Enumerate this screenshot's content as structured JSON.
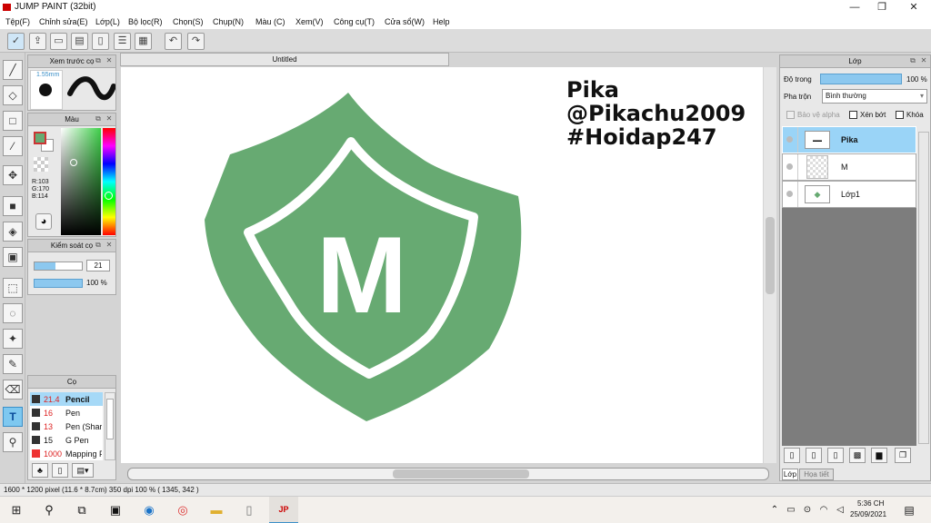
{
  "window": {
    "title": "JUMP PAINT (32bit)"
  },
  "menu": [
    "Tệp(F)",
    "Chỉnh sửa(E)",
    "Lớp(L)",
    "Bộ lọc(R)",
    "Chọn(S)",
    "Chụp(N)",
    "Màu (C)",
    "Xem(V)",
    "Công cụ(T)",
    "Cửa sổ(W)",
    "Help"
  ],
  "panels": {
    "brush_preview": {
      "title": "Xem trước cọ",
      "size": "1.55mm"
    },
    "color": {
      "title": "Màu",
      "r": "R:103",
      "g": "G:170",
      "b": "B:114",
      "fg_color": "#67aa72"
    },
    "control": {
      "title": "Kiểm soát cọ",
      "size_value": "21",
      "opacity_value": "100 %"
    },
    "brush_list": {
      "title": "Cọ",
      "items": [
        {
          "size": "21.4",
          "name": "Pencil"
        },
        {
          "size": "16",
          "name": "Pen"
        },
        {
          "size": "13",
          "name": "Pen (Shar"
        },
        {
          "size": "15",
          "name": "G Pen"
        },
        {
          "size": "1000",
          "name": "Mapping P"
        }
      ]
    }
  },
  "canvas": {
    "tab": "Untitled",
    "text_lines": [
      "Pika",
      "@Pikachu2009",
      "#Hoidap247"
    ],
    "logo_letter": "M",
    "logo_color": "#67aa72"
  },
  "layers": {
    "title": "Lớp",
    "opacity_label": "Độ trong",
    "opacity_value": "100 %",
    "blend_label": "Pha trộn",
    "blend_value": "Bình thường",
    "protect_alpha": "Bảo vệ alpha",
    "clip": "Xén bớt",
    "lock": "Khóa",
    "items": [
      {
        "name": "Pika",
        "active": true
      },
      {
        "name": "M",
        "active": false
      },
      {
        "name": "Lớp1",
        "active": false
      }
    ],
    "tabs": [
      "Lớp",
      "Họa tiết"
    ]
  },
  "status": {
    "text": "1600 * 1200 pixel   (11.6 * 8.7cm)   350 dpi   100 %   ( 1345, 342 )"
  },
  "taskbar": {
    "time": "5:36 CH",
    "date": "25/09/2021"
  }
}
